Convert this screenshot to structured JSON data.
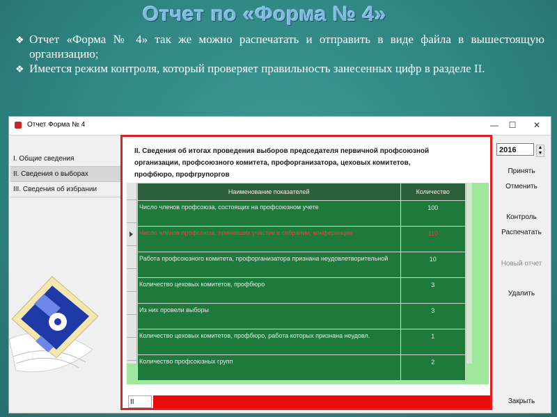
{
  "slide": {
    "title": "Отчет по «Форма № 4»",
    "bullets": [
      "Отчет  «Форма № 4» так же можно распечатать и отправить в виде файла в вышестоящую организацию;",
      "Имеется режим контроля, который проверяет правильность занесенных цифр в разделе II."
    ]
  },
  "window": {
    "title": "Отчет Форма № 4",
    "minimize": "—",
    "maximize": "☐",
    "close": "✕"
  },
  "sidebar": {
    "items": [
      {
        "label": "I.   Общие сведения"
      },
      {
        "label": "II.  Сведения о выборах"
      },
      {
        "label": "III.  Сведения об избрании"
      }
    ]
  },
  "section": {
    "title": "II. Сведения об итогах проведения выборов председателя первичной профсоюзной организации, профсоюзного комитета, профорганизатора, цеховых комитетов, профбюро, профгрупоргов"
  },
  "table": {
    "headers": [
      "Наименование показателей",
      "Количество"
    ],
    "rows": [
      {
        "name": "Число членов профсоюза, состоящих на профсоюзном учете",
        "value": "100"
      },
      {
        "name": "Число членов профсоюза, принявших участие в собрании, конференции",
        "value": "110"
      },
      {
        "name": "Работа профсоюзного комитета, профорганизатора признана неудовлетворительной",
        "value": "10"
      },
      {
        "name": "Количество цеховых комитетов, профбюро",
        "value": "3"
      },
      {
        "name": "Из них провели выборы",
        "value": "3"
      },
      {
        "name": "Количество цеховых комитетов, профбюро, работа которых признана неудовл.",
        "value": "1"
      },
      {
        "name": "Количество профсоюзных групп",
        "value": "2"
      }
    ]
  },
  "status": {
    "section_label": "II"
  },
  "controls": {
    "year": "2016",
    "accept": "Принять",
    "cancel": "Отменить",
    "control": "Контроль",
    "print": "Распечатать",
    "new_report": "Новый отчет",
    "delete": "Удалить",
    "close": "Закрыть"
  },
  "colors": {
    "highlight_text": "#ff3b3b",
    "table_bg": "#1e7a3a",
    "panel_border": "#e02020",
    "light_green": "#9fe79b"
  }
}
